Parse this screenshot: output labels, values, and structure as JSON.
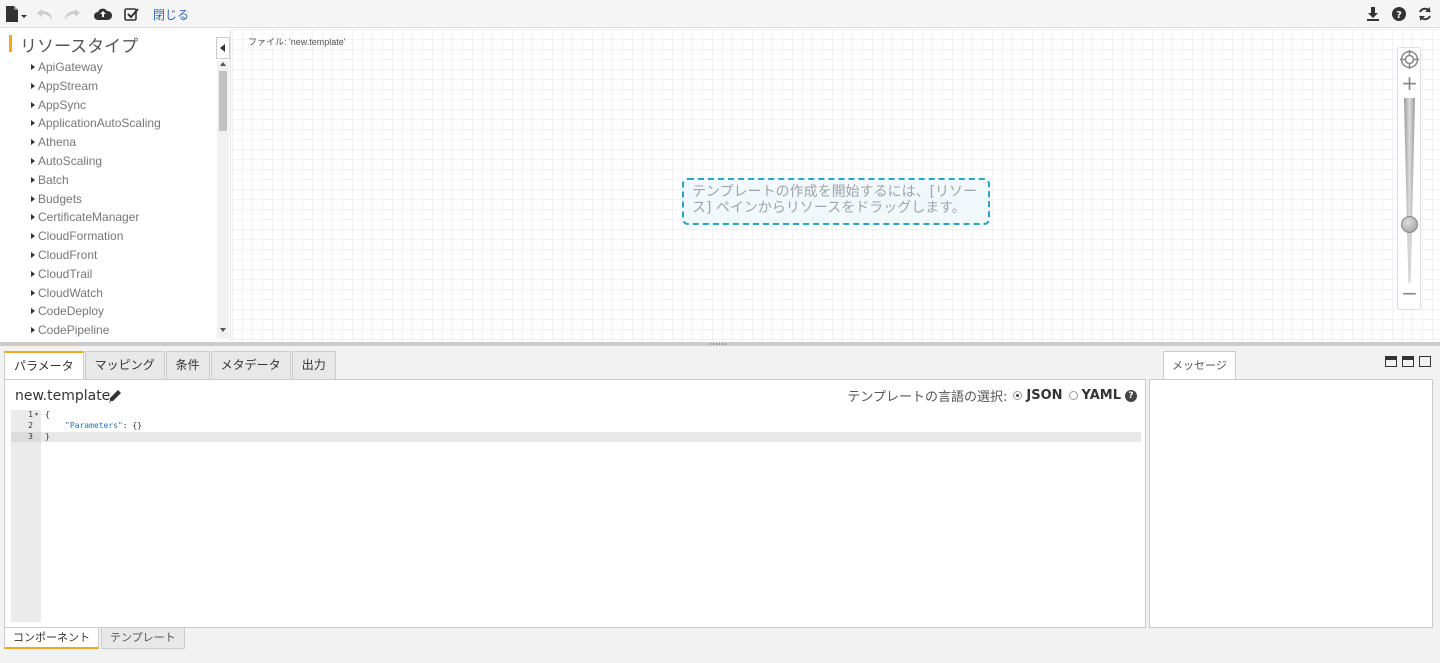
{
  "toolbar": {
    "close_label": "閉じる",
    "icons": [
      "file-menu-icon",
      "undo-icon",
      "redo-icon",
      "cloud-upload-icon",
      "validate-icon",
      "download-icon",
      "help-icon",
      "refresh-icon"
    ]
  },
  "resources": {
    "title": "リソースタイプ",
    "items": [
      "ApiGateway",
      "AppStream",
      "AppSync",
      "ApplicationAutoScaling",
      "Athena",
      "AutoScaling",
      "Batch",
      "Budgets",
      "CertificateManager",
      "CloudFormation",
      "CloudFront",
      "CloudTrail",
      "CloudWatch",
      "CodeDeploy",
      "CodePipeline"
    ]
  },
  "canvas": {
    "file_label": "ファイル: 'new.template'",
    "hint": "テンプレートの作成を開始するには、[リソース] ペインからリソースをドラッグします。"
  },
  "editor": {
    "tabs": [
      "パラメータ",
      "マッピング",
      "条件",
      "メタデータ",
      "出力"
    ],
    "active_tab": "パラメータ",
    "template_name": "new.template",
    "lang_label": "テンプレートの言語の選択:",
    "lang_json": "JSON",
    "lang_yaml": "YAML",
    "lang_selected": "JSON",
    "line_numbers": [
      "1",
      "2",
      "3"
    ],
    "code_open": "{",
    "code_key": "\"Parameters\"",
    "code_rest": ": {}",
    "code_close": "}"
  },
  "messages": {
    "tab_label": "メッセージ"
  },
  "bottom_tabs": [
    "コンポーネント",
    "テンプレート"
  ],
  "colors": {
    "accent": "#f0a820",
    "link": "#2a6ebb",
    "hint_border": "#29a3c7"
  }
}
